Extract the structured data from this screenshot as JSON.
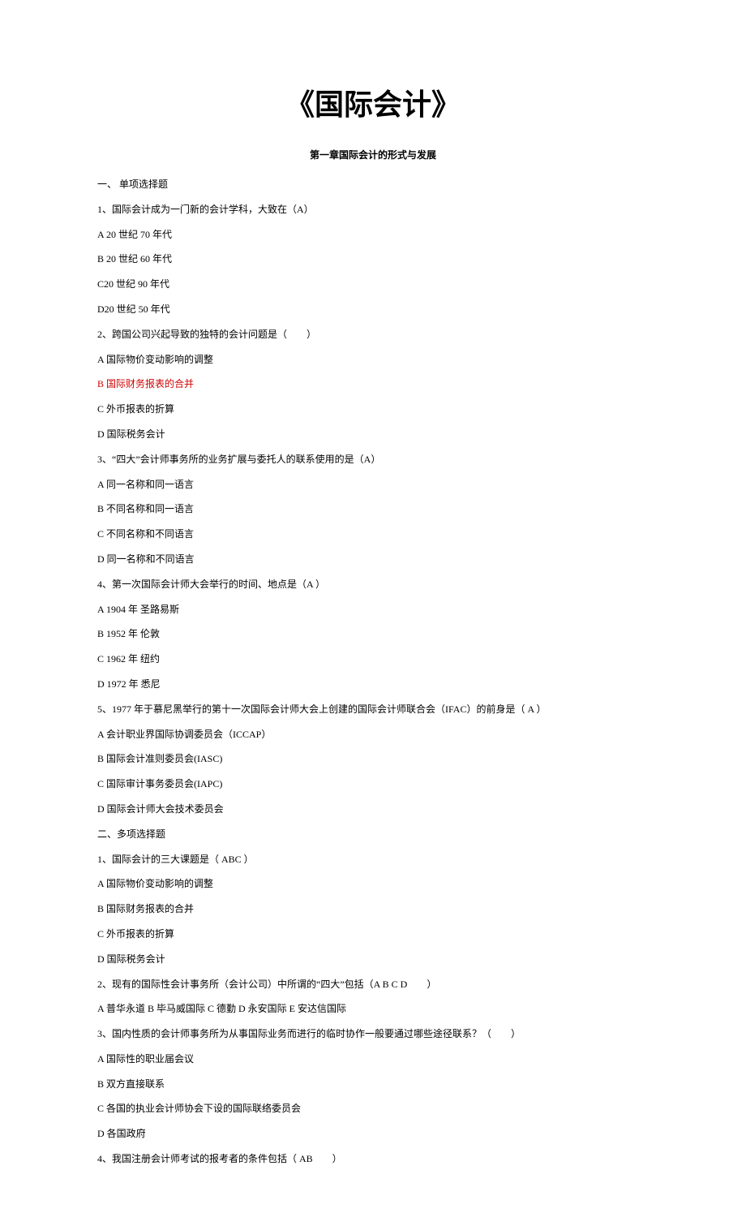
{
  "title": "《国际会计》",
  "chapter": "第一章国际会计的形式与发展",
  "lines": [
    {
      "text": "一、 单项选择题",
      "highlight": false
    },
    {
      "text": "1、国际会计成为一门新的会计学科，大致在（A）",
      "highlight": false
    },
    {
      "text": "A 20 世纪 70 年代",
      "highlight": false
    },
    {
      "text": "B 20 世纪 60 年代",
      "highlight": false
    },
    {
      "text": "C20 世纪 90 年代",
      "highlight": false
    },
    {
      "text": "D20 世纪 50 年代",
      "highlight": false
    },
    {
      "text": "2、跨国公司兴起导致的独特的会计问题是（　　）",
      "highlight": false
    },
    {
      "text": "A  国际物价变动影响的调整",
      "highlight": false
    },
    {
      "text": "B  国际财务报表的合并",
      "highlight": true
    },
    {
      "text": "C  外币报表的折算",
      "highlight": false
    },
    {
      "text": "D  国际税务会计",
      "highlight": false
    },
    {
      "text": "3、“四大”会计师事务所的业务扩展与委托人的联系使用的是（A）",
      "highlight": false
    },
    {
      "text": "A  同一名称和同一语言",
      "highlight": false
    },
    {
      "text": "B  不同名称和同一语言",
      "highlight": false
    },
    {
      "text": "C  不同名称和不同语言",
      "highlight": false
    },
    {
      "text": "D  同一名称和不同语言",
      "highlight": false
    },
    {
      "text": "4、第一次国际会计师大会举行的时间、地点是（A  ）",
      "highlight": false
    },
    {
      "text": "A 1904 年  圣路易斯",
      "highlight": false
    },
    {
      "text": "B 1952 年  伦敦",
      "highlight": false
    },
    {
      "text": "C 1962 年  纽约",
      "highlight": false
    },
    {
      "text": "D 1972 年  悉尼",
      "highlight": false
    },
    {
      "text": "5、1977 年于慕尼黑举行的第十一次国际会计师大会上创建的国际会计师联合会（IFAC）的前身是（  A  ）",
      "highlight": false
    },
    {
      "text": "A  会计职业界国际协调委员会（ICCAP）",
      "highlight": false
    },
    {
      "text": "B  国际会计准则委员会(IASC)",
      "highlight": false
    },
    {
      "text": "C  国际审计事务委员会(IAPC)",
      "highlight": false
    },
    {
      "text": "D  国际会计师大会技术委员会",
      "highlight": false
    },
    {
      "text": "二、多项选择题",
      "highlight": false
    },
    {
      "text": "1、国际会计的三大课题是（  ABC  ）",
      "highlight": false
    },
    {
      "text": "A  国际物价变动影响的调整",
      "highlight": false
    },
    {
      "text": "B  国际财务报表的合并",
      "highlight": false
    },
    {
      "text": "C  外币报表的折算",
      "highlight": false
    },
    {
      "text": "D  国际税务会计",
      "highlight": false
    },
    {
      "text": "2、现有的国际性会计事务所（会计公司）中所谓的“四大”包括（A B C D　　）",
      "highlight": false
    },
    {
      "text": "A 普华永道  B 毕马威国际  C 德勤  D 永安国际  E 安达信国际",
      "highlight": false
    },
    {
      "text": "3、国内性质的会计师事务所为从事国际业务而进行的临时协作一般要通过哪些途径联系？（　　）",
      "highlight": false
    },
    {
      "text": "A  国际性的职业届会议",
      "highlight": false
    },
    {
      "text": "B  双方直接联系",
      "highlight": false
    },
    {
      "text": "C  各国的执业会计师协会下设的国际联络委员会",
      "highlight": false
    },
    {
      "text": "D  各国政府",
      "highlight": false
    },
    {
      "text": "4、我国注册会计师考试的报考者的条件包括（  AB　　）",
      "highlight": false
    }
  ]
}
